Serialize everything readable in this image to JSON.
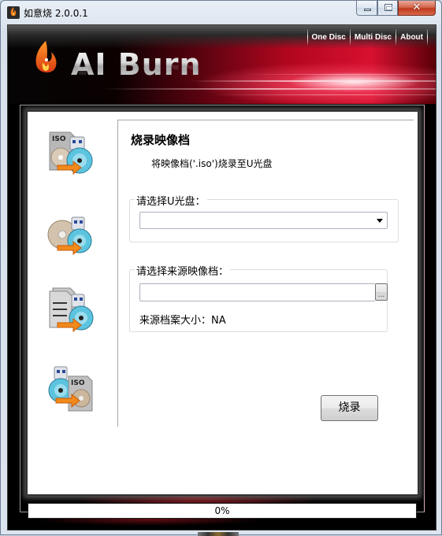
{
  "window": {
    "title": "如意烧 2.0.0.1",
    "controls": {
      "minimize": "minimize",
      "maximize": "maximize",
      "close": "✕"
    }
  },
  "banner": {
    "logo_text": "AI Burn",
    "nav": [
      {
        "label": "One Disc"
      },
      {
        "label": "Multi Disc"
      },
      {
        "label": "About"
      }
    ]
  },
  "sidebar": {
    "items": [
      {
        "name": "iso-to-usb",
        "icon": "iso-file-to-usb-disc-icon"
      },
      {
        "name": "disc-to-usb",
        "icon": "disc-to-usb-disc-icon"
      },
      {
        "name": "files-to-usb",
        "icon": "files-to-usb-disc-icon"
      },
      {
        "name": "usb-to-iso",
        "icon": "usb-disc-to-iso-file-icon"
      }
    ],
    "active_index": 0
  },
  "main": {
    "heading": "烧录映像档",
    "subheading": "将映像档('.iso')烧录至U光盘",
    "usb_group": {
      "label": "请选择U光盘：",
      "selected_value": ""
    },
    "source_group": {
      "label": "请选择来源映像档：",
      "path_value": "",
      "browse_label": "...",
      "size_label": "来源档案大小：",
      "size_value": "NA"
    },
    "burn_button": "烧录"
  },
  "progress": {
    "percent": 0,
    "label": "0%"
  },
  "colors": {
    "accent_red": "#d81030",
    "banner_dark": "#050505"
  }
}
